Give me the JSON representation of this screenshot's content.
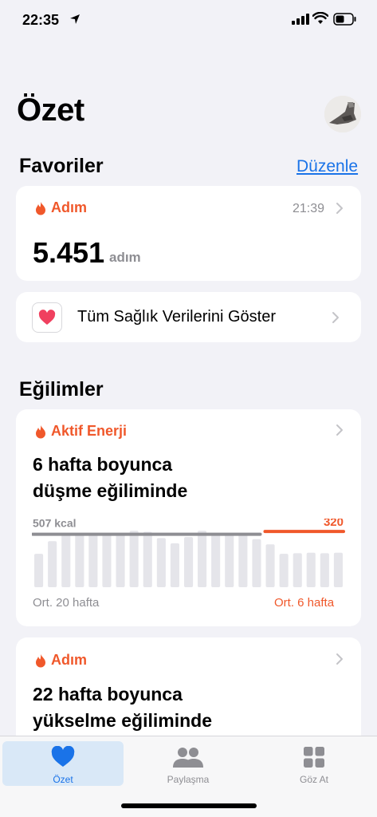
{
  "status_bar": {
    "time": "22:35"
  },
  "header": {
    "title": "Özet"
  },
  "favorites": {
    "section_title": "Favoriler",
    "edit_label": "Düzenle",
    "steps_card": {
      "label": "Adım",
      "time": "21:39",
      "value": "5.451",
      "unit": "adım"
    },
    "show_all_label": "Tüm Sağlık Verilerini Göster"
  },
  "trends": {
    "section_title": "Eğilimler",
    "energy_card": {
      "label": "Aktif Enerji",
      "headline_line1": "6 hafta boyunca",
      "headline_line2": "düşme eğiliminde",
      "avg_long_value": "507 kcal",
      "avg_short_value": "320",
      "avg_long_caption": "Ort. 20 hafta",
      "avg_short_caption": "Ort. 6 hafta"
    },
    "steps_card": {
      "label": "Adım",
      "headline_line1": "22 hafta boyunca",
      "headline_line2": "yükselme eğiliminde"
    }
  },
  "chart_data": {
    "type": "bar",
    "values": [
      320,
      440,
      500,
      510,
      520,
      510,
      505,
      540,
      530,
      470,
      420,
      480,
      540,
      500,
      510,
      520,
      460,
      410,
      320,
      325,
      330,
      325,
      330
    ],
    "avg_long": 507,
    "avg_short": 320,
    "long_color": "#8e8e93",
    "short_color": "#f0582b",
    "bar_color": "#e5e5ea"
  },
  "tab_bar": {
    "tabs": [
      {
        "label": "Özet",
        "icon": "heart-icon",
        "active": true
      },
      {
        "label": "Paylaşma",
        "icon": "people-icon",
        "active": false
      },
      {
        "label": "Göz At",
        "icon": "grid-icon",
        "active": false
      }
    ],
    "active_color": "#1a73e8"
  }
}
